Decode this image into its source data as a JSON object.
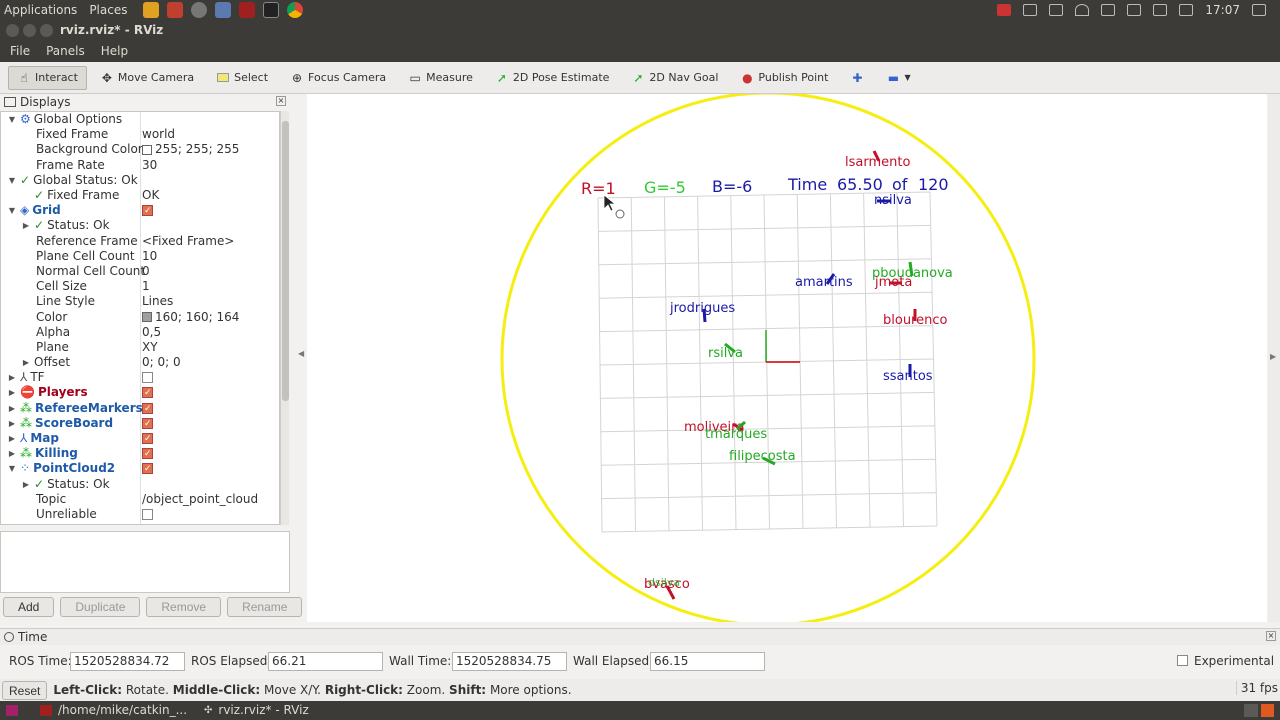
{
  "topbar": {
    "apps": "Applications",
    "places": "Places",
    "clock": "17:07"
  },
  "window": {
    "title": "rviz.rviz* - RViz"
  },
  "menubar": {
    "file": "File",
    "panels": "Panels",
    "help": "Help"
  },
  "toolbar": {
    "interact": "Interact",
    "move_camera": "Move Camera",
    "select": "Select",
    "focus_camera": "Focus Camera",
    "measure": "Measure",
    "pose_estimate": "2D Pose Estimate",
    "nav_goal": "2D Nav Goal",
    "publish_point": "Publish Point"
  },
  "displays": {
    "title": "Displays",
    "rows": [
      {
        "label": "Global Options",
        "value": ""
      },
      {
        "label": "Fixed Frame",
        "value": "world"
      },
      {
        "label": "Background Color",
        "value": "255; 255; 255"
      },
      {
        "label": "Frame Rate",
        "value": "30"
      },
      {
        "label": "Global Status: Ok",
        "value": ""
      },
      {
        "label": "Fixed Frame",
        "value": "OK"
      },
      {
        "label": "Grid",
        "value": ""
      },
      {
        "label": "Status: Ok",
        "value": ""
      },
      {
        "label": "Reference Frame",
        "value": "<Fixed Frame>"
      },
      {
        "label": "Plane Cell Count",
        "value": "10"
      },
      {
        "label": "Normal Cell Count",
        "value": "0"
      },
      {
        "label": "Cell Size",
        "value": "1"
      },
      {
        "label": "Line Style",
        "value": "Lines"
      },
      {
        "label": "Color",
        "value": "160; 160; 164"
      },
      {
        "label": "Alpha",
        "value": "0,5"
      },
      {
        "label": "Plane",
        "value": "XY"
      },
      {
        "label": "Offset",
        "value": "0; 0; 0"
      },
      {
        "label": "TF",
        "value": ""
      },
      {
        "label": "Players",
        "value": ""
      },
      {
        "label": "RefereeMarkers",
        "value": ""
      },
      {
        "label": "ScoreBoard",
        "value": ""
      },
      {
        "label": "Map",
        "value": ""
      },
      {
        "label": "Killing",
        "value": ""
      },
      {
        "label": "PointCloud2",
        "value": ""
      },
      {
        "label": "Status: Ok",
        "value": ""
      },
      {
        "label": "Topic",
        "value": "/object_point_cloud"
      },
      {
        "label": "Unreliable",
        "value": ""
      }
    ],
    "buttons": {
      "add": "Add",
      "duplicate": "Duplicate",
      "remove": "Remove",
      "rename": "Rename"
    }
  },
  "scene": {
    "score_r": "R=1",
    "score_g": "G=-5",
    "score_b": "B=-6",
    "time_label": "Time",
    "time_value": "65.50",
    "time_of": "of",
    "time_total": "120",
    "players": [
      {
        "name": "lsarmento",
        "color": "#c0102a"
      },
      {
        "name": "nsilva",
        "color": "#1a1aa8"
      },
      {
        "name": "pboudanova",
        "color": "#22aa22"
      },
      {
        "name": "amartins",
        "color": "#1a1aa8"
      },
      {
        "name": "jmota",
        "color": "#c0102a"
      },
      {
        "name": "jrodrigues",
        "color": "#1a1aa8"
      },
      {
        "name": "blourenco",
        "color": "#c0102a"
      },
      {
        "name": "rsilva",
        "color": "#22aa22"
      },
      {
        "name": "ssantos",
        "color": "#1a1aa8"
      },
      {
        "name": "moliveira",
        "color": "#c0102a"
      },
      {
        "name": "tmarques",
        "color": "#22aa22"
      },
      {
        "name": "filipecosta",
        "color": "#22aa22"
      },
      {
        "name": "bvasco",
        "color": "#c0102a"
      },
      {
        "name": "dsilva",
        "color": "#22aa22"
      }
    ],
    "arena_color": "#f5ee10"
  },
  "time_panel": {
    "title": "Time",
    "ros_time_label": "ROS Time:",
    "ros_time": "1520528834.72",
    "ros_elapsed_label": "ROS Elapsed:",
    "ros_elapsed": "66.21",
    "wall_time_label": "Wall Time:",
    "wall_time": "1520528834.75",
    "wall_elapsed_label": "Wall Elapsed:",
    "wall_elapsed": "66.15",
    "experimental": "Experimental"
  },
  "status": {
    "reset": "Reset",
    "left_click": "Left-Click:",
    "left_desc": "Rotate.",
    "middle_click": "Middle-Click:",
    "middle_desc": "Move X/Y.",
    "right_click": "Right-Click:",
    "right_desc": "Zoom.",
    "shift": "Shift:",
    "shift_desc": "More options.",
    "fps": "31 fps"
  },
  "taskbar": {
    "terminal": "/home/mike/catkin_...",
    "rviz": "rviz.rviz* - RViz"
  }
}
